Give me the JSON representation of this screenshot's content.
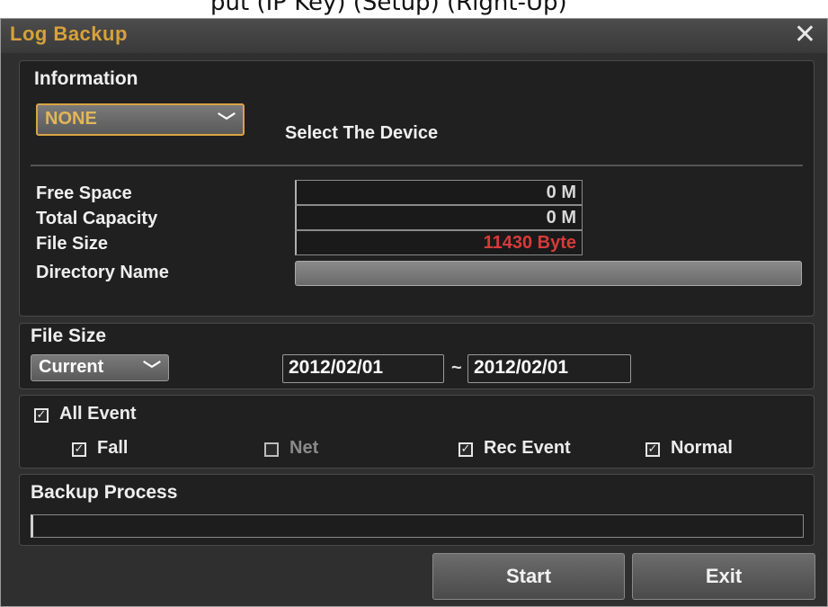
{
  "top_caption": "put (IP Key) (Setup) (Right-Up)",
  "dialog": {
    "title": "Log Backup",
    "close_glyph": "✕"
  },
  "information": {
    "heading": "Information",
    "device_dropdown": {
      "value": "NONE",
      "icon": "chevron-down-icon"
    },
    "select_label": "Select The Device",
    "rows": [
      {
        "label": "Free Space",
        "value": "0 M"
      },
      {
        "label": "Total Capacity",
        "value": "0 M"
      },
      {
        "label": "File Size",
        "value": "11430 Byte",
        "color": "#d73a3a"
      }
    ],
    "directory_label": "Directory Name",
    "directory_value": ""
  },
  "file_size": {
    "heading": "File Size",
    "dropdown_value": "Current",
    "start_date": "2012/02/01",
    "separator": "~",
    "end_date": "2012/02/01"
  },
  "events": {
    "all": {
      "label": "All Event",
      "checked": true
    },
    "items": [
      {
        "label": "Fall",
        "checked": true
      },
      {
        "label": "Net",
        "checked": false
      },
      {
        "label": "Rec Event",
        "checked": true
      },
      {
        "label": "Normal",
        "checked": true
      }
    ]
  },
  "backup": {
    "heading": "Backup Process",
    "progress": 0
  },
  "buttons": {
    "start": "Start",
    "exit": "Exit"
  },
  "colors": {
    "accent": "#d7a23a",
    "warning": "#d73a3a",
    "panel": "#202020"
  }
}
